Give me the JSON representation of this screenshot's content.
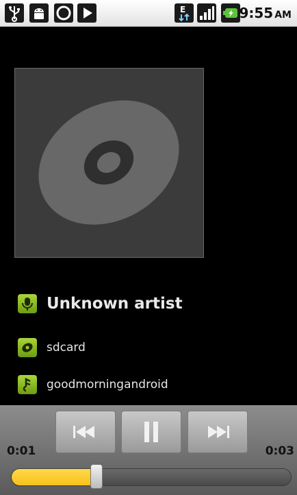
{
  "status_bar": {
    "time": "9:55",
    "ampm": "AM",
    "network_label": "E",
    "icons": [
      "usb-icon",
      "android-debug-icon",
      "sync-icon",
      "play-notification-icon",
      "data-network-icon",
      "signal-icon",
      "battery-charging-icon"
    ]
  },
  "track_info": {
    "artist": "Unknown artist",
    "album": "sdcard",
    "title": "goodmorningandroid"
  },
  "playback": {
    "current_time": "0:01",
    "total_time": "0:03",
    "progress_fraction": 0.31,
    "state": "playing"
  },
  "colors": {
    "accent_green": "#8fbf25",
    "seek_fill": "#f7c11a"
  }
}
